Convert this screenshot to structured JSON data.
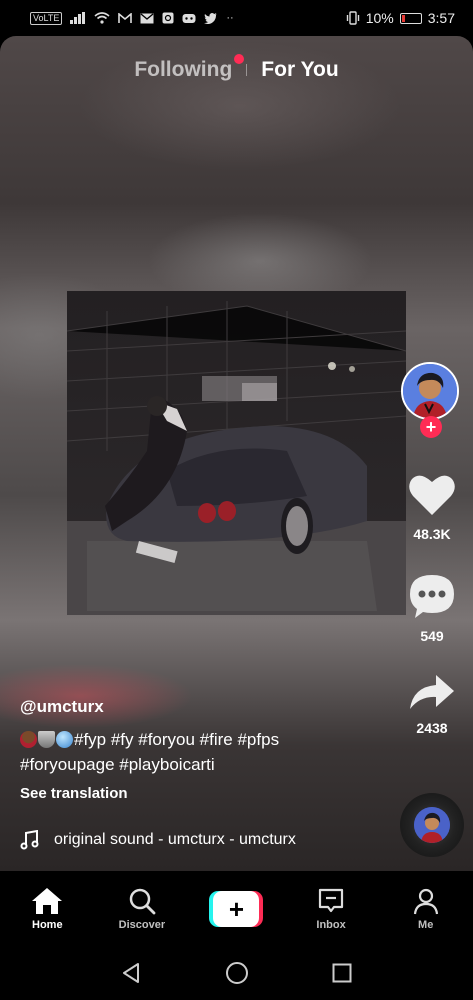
{
  "statusbar": {
    "left_icons": [
      "volte-icon",
      "signal-icon",
      "wifi-icon",
      "gmail-icon",
      "mail-icon",
      "instagram-icon",
      "discord-icon",
      "twitter-icon",
      "more-icon"
    ],
    "volte": "VoLTE",
    "more": "··",
    "battery_pct": "10%",
    "time": "3:57"
  },
  "feed_tabs": {
    "following": "Following",
    "for_you": "For You",
    "active": "For You"
  },
  "actions": {
    "likes": "48.3K",
    "comments": "549",
    "shares": "2438"
  },
  "caption": {
    "username": "@umcturx",
    "tags_line1": "#fyp #fy #foryou #fire #pfps",
    "tags_line2": "#foryoupage #playboicarti",
    "see_translation": "See translation",
    "emojis": [
      "person-emoji",
      "tornado-emoji",
      "crystal-ball-emoji"
    ]
  },
  "sound": {
    "label": "original sound - umcturx - umcturx",
    "icon": "music-note-icon"
  },
  "bottom_nav": {
    "items": [
      {
        "label": "Home",
        "icon": "home-icon",
        "active": true
      },
      {
        "label": "Discover",
        "icon": "search-icon",
        "active": false
      },
      {
        "label": "",
        "icon": "create-plus-icon",
        "active": false
      },
      {
        "label": "Inbox",
        "icon": "inbox-icon",
        "active": false
      },
      {
        "label": "Me",
        "icon": "profile-icon",
        "active": false
      }
    ],
    "create_symbol": "+"
  },
  "system_nav": [
    "back-icon",
    "home-circle-icon",
    "recents-icon"
  ],
  "colors": {
    "accent": "#ff2c55",
    "cyan": "#25f4ee",
    "background": "#000000"
  }
}
